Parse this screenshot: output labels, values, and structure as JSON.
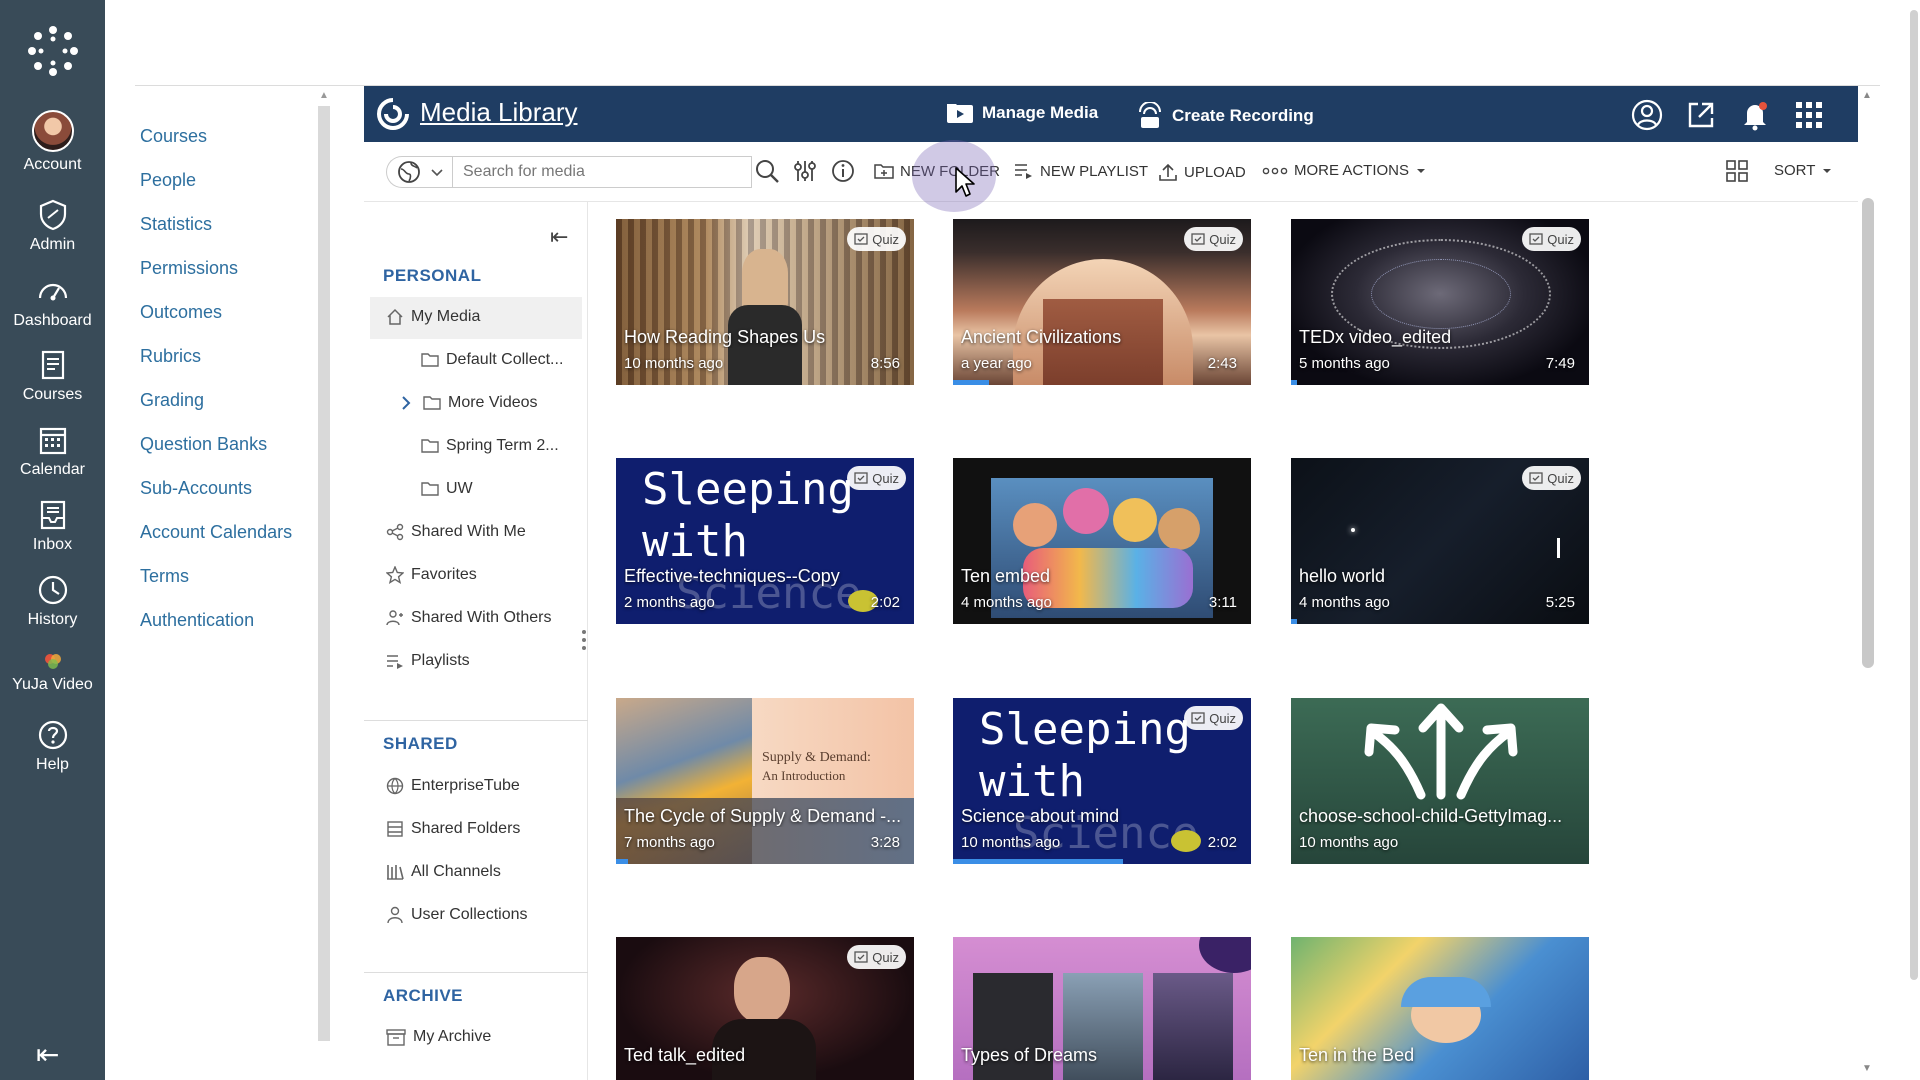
{
  "global_nav": {
    "items": [
      {
        "label": "Account",
        "icon": "avatar"
      },
      {
        "label": "Admin",
        "icon": "shield-icon"
      },
      {
        "label": "Dashboard",
        "icon": "dashboard-icon"
      },
      {
        "label": "Courses",
        "icon": "book-icon"
      },
      {
        "label": "Calendar",
        "icon": "calendar-icon"
      },
      {
        "label": "Inbox",
        "icon": "inbox-icon"
      },
      {
        "label": "History",
        "icon": "clock-icon"
      },
      {
        "label": "YuJa Video",
        "icon": "yuja-icon"
      },
      {
        "label": "Help",
        "icon": "help-icon"
      }
    ]
  },
  "course_nav": {
    "items": [
      "Courses",
      "People",
      "Statistics",
      "Permissions",
      "Outcomes",
      "Rubrics",
      "Grading",
      "Question Banks",
      "Sub-Accounts",
      "Account Calendars",
      "Terms",
      "Authentication"
    ]
  },
  "header": {
    "title": "Media Library",
    "manage_media": "Manage Media",
    "create_recording": "Create Recording"
  },
  "toolbar": {
    "search_placeholder": "Search for media",
    "new_folder": "NEW FOLDER",
    "new_playlist": "NEW PLAYLIST",
    "upload": "UPLOAD",
    "more_actions": "MORE ACTIONS",
    "sort": "SORT"
  },
  "library": {
    "personal_title": "PERSONAL",
    "my_media": "My Media",
    "folders": [
      "Default Collect...",
      "More Videos",
      "Spring Term 2...",
      "UW"
    ],
    "shared_with_me": "Shared With Me",
    "favorites": "Favorites",
    "shared_with_others": "Shared With Others",
    "playlists": "Playlists",
    "shared_title": "SHARED",
    "enterprise_tube": "EnterpriseTube",
    "shared_folders": "Shared Folders",
    "all_channels": "All Channels",
    "user_collections": "User Collections",
    "archive_title": "ARCHIVE",
    "my_archive": "My Archive"
  },
  "quiz_label": "Quiz",
  "media": [
    {
      "title": "How Reading Shapes Us",
      "date": "10 months ago",
      "duration": "8:56",
      "quiz": true,
      "progress": 0
    },
    {
      "title": "Ancient Civilizations",
      "date": "a year ago",
      "duration": "2:43",
      "quiz": true,
      "progress": 0.12
    },
    {
      "title": "TEDx video_edited",
      "date": "5 months ago",
      "duration": "7:49",
      "quiz": true,
      "progress": 0.02
    },
    {
      "title": "Effective-techniques--Copy",
      "date": "2 months ago",
      "duration": "2:02",
      "quiz": true,
      "progress": 0,
      "overlay": "Sleeping with",
      "ghost": "Science"
    },
    {
      "title": "Ten embed",
      "date": "4 months ago",
      "duration": "3:11",
      "quiz": false,
      "progress": 0
    },
    {
      "title": "hello world",
      "date": "4 months ago",
      "duration": "5:25",
      "quiz": true,
      "progress": 0.02
    },
    {
      "title": "The Cycle of Supply & Demand -...",
      "date": "7 months ago",
      "duration": "3:28",
      "quiz": false,
      "progress": 0.04,
      "subtitle1": "Supply & Demand:",
      "subtitle2": "An Introduction"
    },
    {
      "title": "Science about mind",
      "date": "10 months ago",
      "duration": "2:02",
      "quiz": true,
      "progress": 0.57,
      "overlay": "Sleeping with",
      "ghost": "Science"
    },
    {
      "title": "choose-school-child-GettyImag...",
      "date": "10 months ago",
      "duration": "",
      "quiz": false,
      "progress": 0
    },
    {
      "title": "Ted talk_edited",
      "date": "",
      "duration": "",
      "quiz": true,
      "progress": 0
    },
    {
      "title": "Types of Dreams",
      "date": "",
      "duration": "",
      "quiz": false,
      "progress": 0
    },
    {
      "title": "Ten in the Bed",
      "date": "",
      "duration": "",
      "quiz": false,
      "progress": 0
    }
  ]
}
